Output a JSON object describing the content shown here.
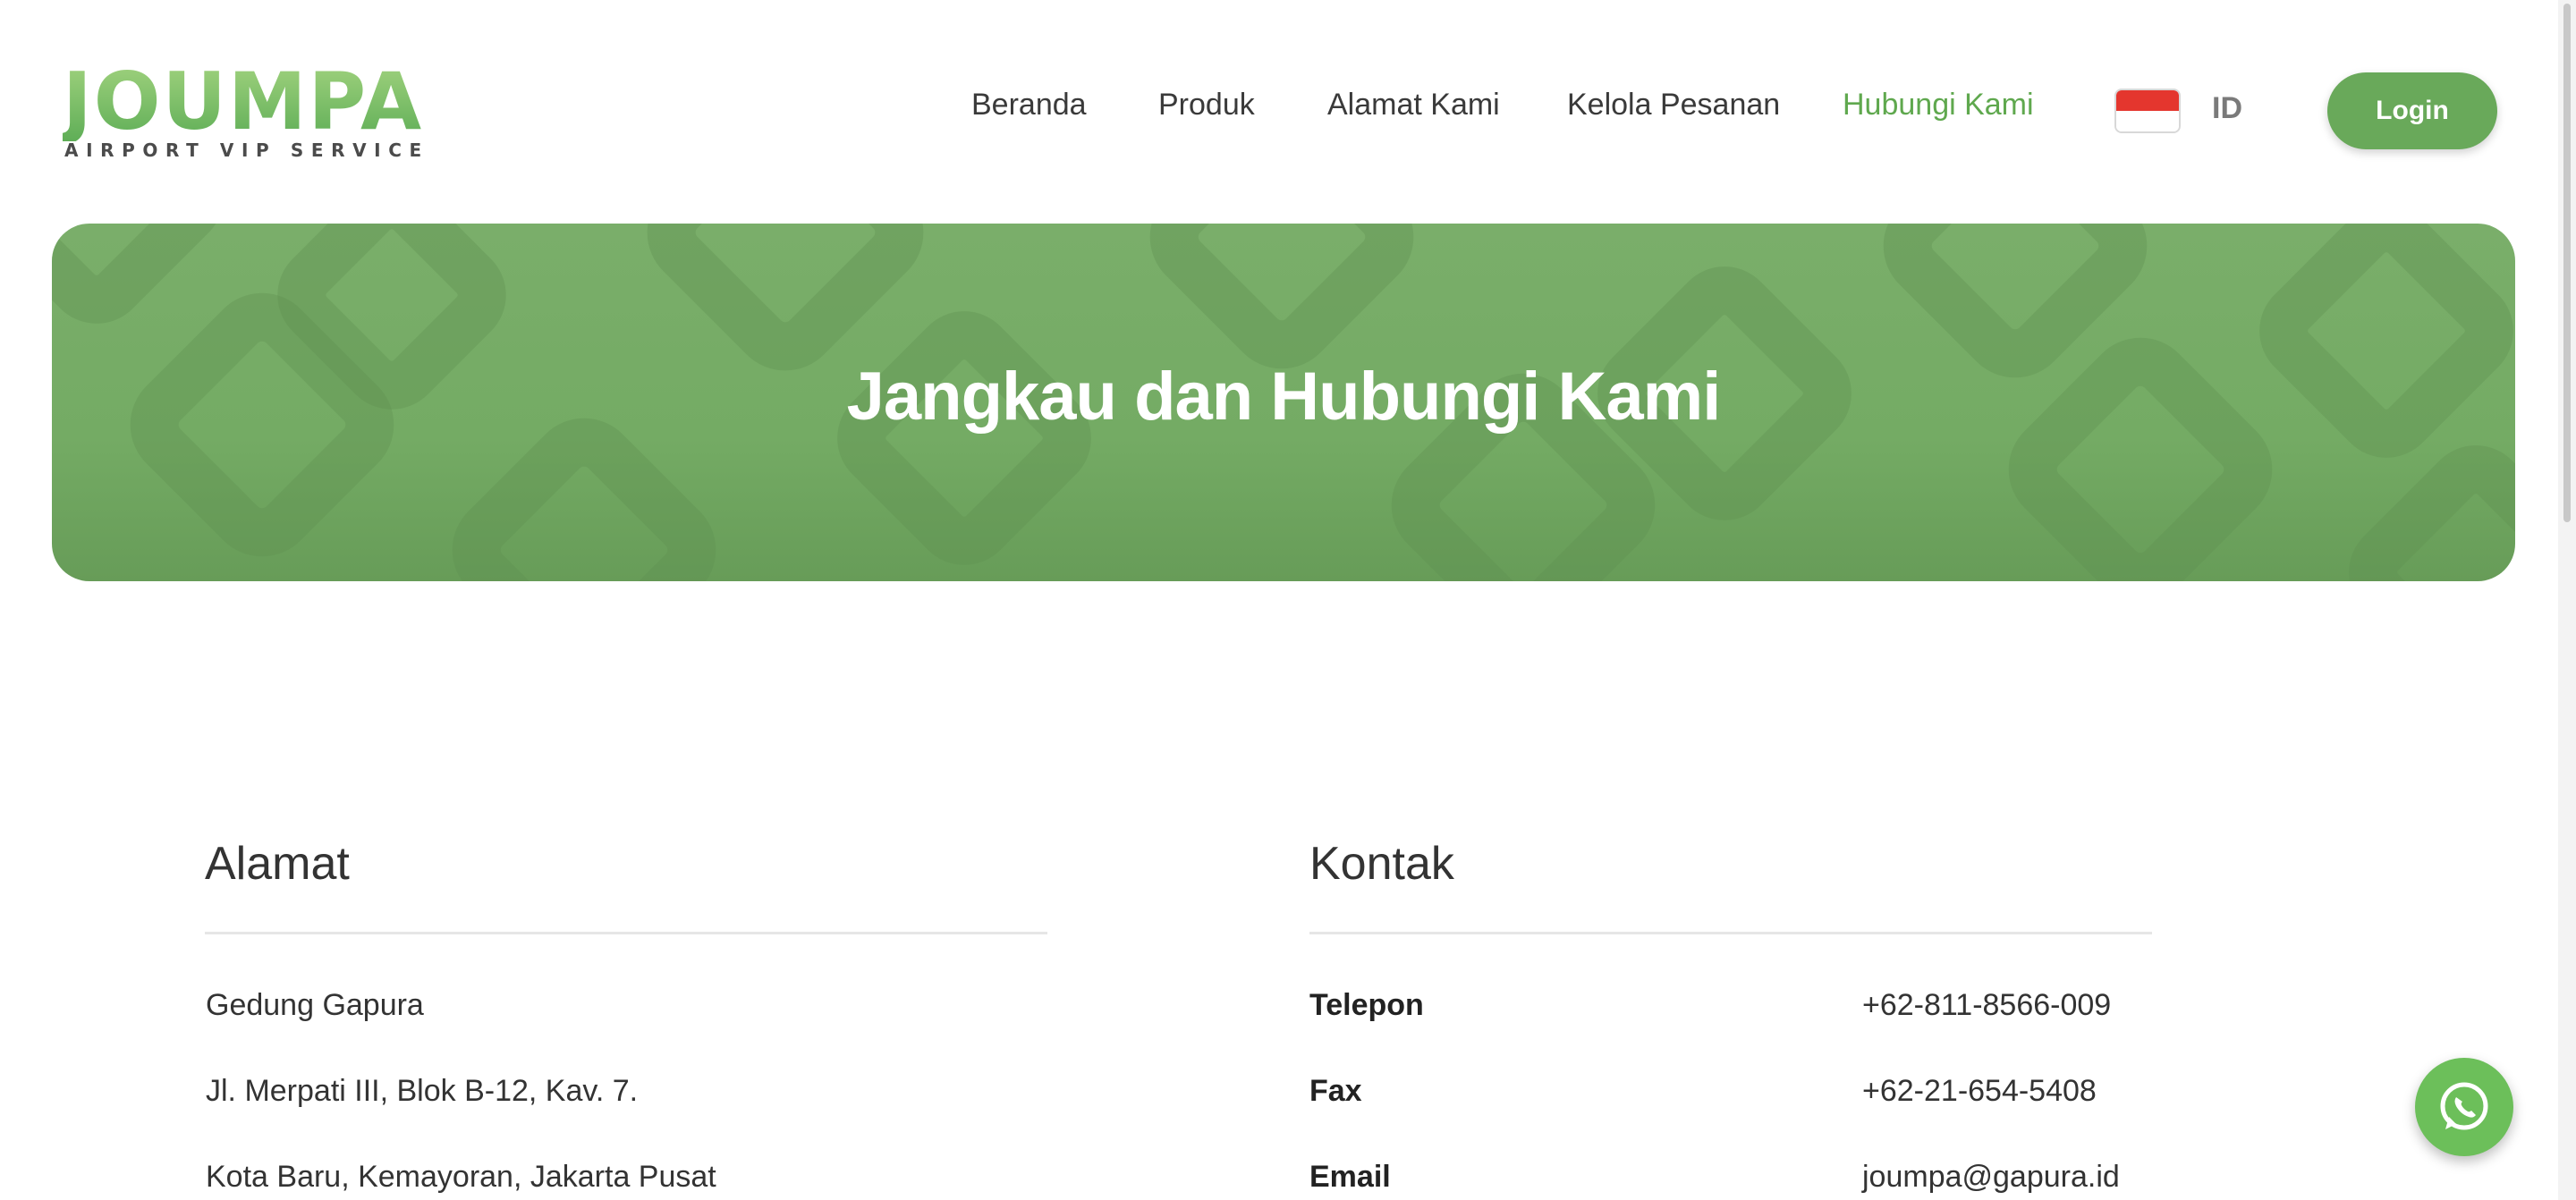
{
  "brand": {
    "name": "JOUMPA",
    "tagline": "AIRPORT VIP SERVICE",
    "accent": "#69a95a",
    "active_nav_color": "#5fa84e"
  },
  "nav": {
    "items": [
      {
        "label": "Beranda",
        "active": false
      },
      {
        "label": "Produk",
        "active": false
      },
      {
        "label": "Alamat Kami",
        "active": false
      },
      {
        "label": "Kelola Pesanan",
        "active": false
      },
      {
        "label": "Hubungi Kami",
        "active": true
      }
    ],
    "language_flag": "indonesia-flag-icon",
    "language": "ID",
    "login_label": "Login"
  },
  "hero": {
    "title": "Jangkau dan Hubungi Kami",
    "background": "#74ab64"
  },
  "address": {
    "heading": "Alamat",
    "lines": [
      "Gedung Gapura",
      "Jl. Merpati III, Blok B-12, Kav. 7.",
      "Kota Baru, Kemayoran, Jakarta Pusat"
    ]
  },
  "contact": {
    "heading": "Kontak",
    "rows": [
      {
        "label": "Telepon",
        "value": "+62-811-8566-009"
      },
      {
        "label": "Fax",
        "value": "+62-21-654-5408"
      },
      {
        "label": "Email",
        "value": "joumpa@gapura.id"
      }
    ]
  },
  "floating": {
    "whatsapp_icon": "whatsapp-icon",
    "color": "#6cbf5a"
  }
}
